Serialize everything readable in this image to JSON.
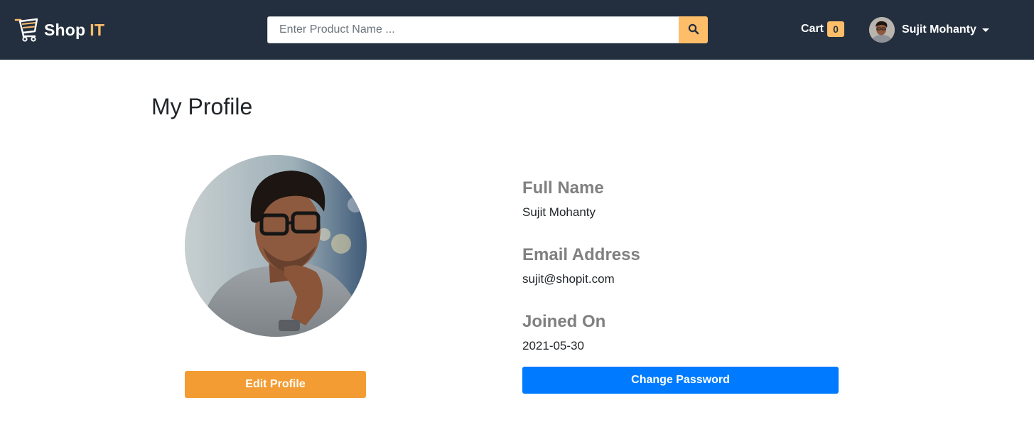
{
  "navbar": {
    "brand_shop": "Shop",
    "brand_it": "IT",
    "search": {
      "placeholder": "Enter Product Name ..."
    },
    "cart": {
      "label": "Cart",
      "count": "0"
    },
    "user": {
      "name": "Sujit Mohanty"
    }
  },
  "profile": {
    "title": "My Profile",
    "edit_button": "Edit Profile",
    "fields": {
      "full_name": {
        "label": "Full Name",
        "value": "Sujit Mohanty"
      },
      "email": {
        "label": "Email Address",
        "value": "sujit@shopit.com"
      },
      "joined": {
        "label": "Joined On",
        "value": "2021-05-30"
      }
    },
    "change_password_button": "Change Password"
  },
  "colors": {
    "navbar_bg": "#232f3e",
    "accent": "#febd69",
    "edit_button": "#f39c33",
    "primary_button": "#007bff",
    "field_label": "#808080"
  },
  "icons": {
    "logo": "shopping-cart-logo-icon",
    "search": "search-icon",
    "dropdown": "caret-down-icon"
  }
}
